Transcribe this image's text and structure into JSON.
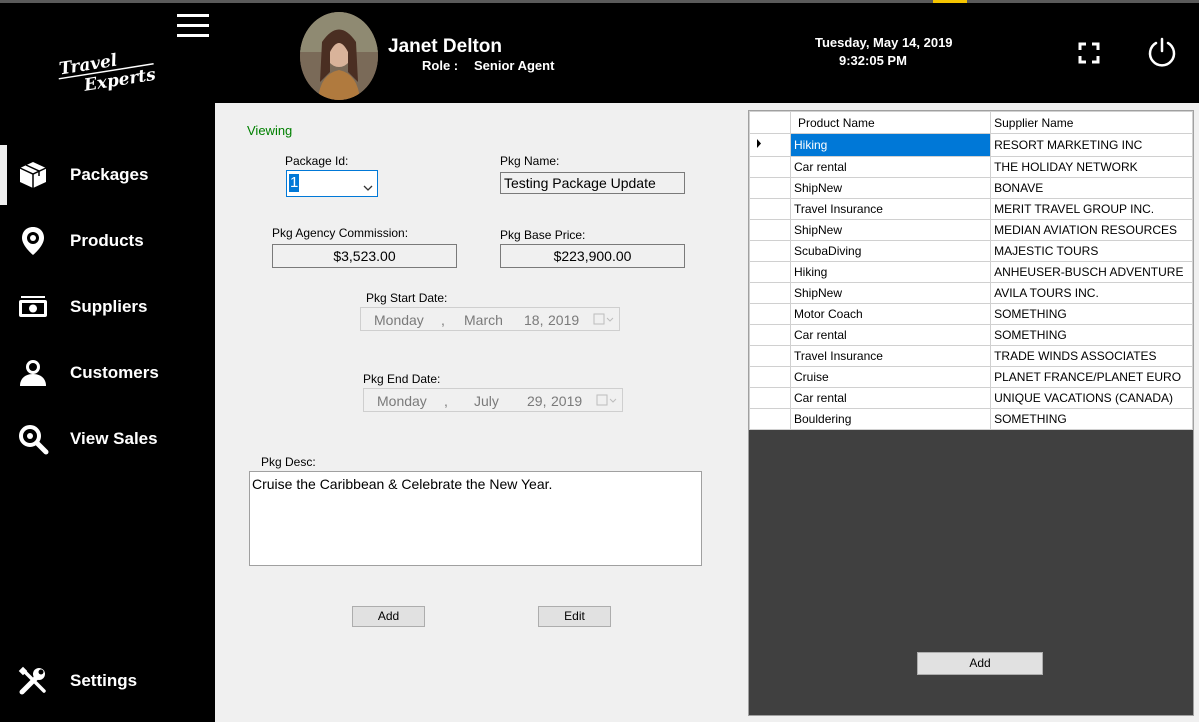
{
  "header": {
    "logo_line1": "Travel",
    "logo_line2": "Experts",
    "user_name": "Janet Delton",
    "role_label": "Role :",
    "role_value": "Senior Agent",
    "date": "Tuesday, May 14, 2019",
    "time": "9:32:05 PM",
    "icons": [
      "hamburger-menu-icon",
      "fullscreen-icon",
      "power-icon"
    ]
  },
  "sidebar": {
    "items": [
      {
        "label": "Packages",
        "icon": "package-box-icon",
        "active": true
      },
      {
        "label": "Products",
        "icon": "location-pin-icon"
      },
      {
        "label": "Suppliers",
        "icon": "money-stack-icon"
      },
      {
        "label": "Customers",
        "icon": "users-icon"
      },
      {
        "label": "View Sales",
        "icon": "magnifier-icon"
      },
      {
        "label": "Settings",
        "icon": "wrench-screwdriver-icon"
      }
    ]
  },
  "form": {
    "mode_text": "Viewing",
    "package_id_label": "Package Id:",
    "package_id_value": "1",
    "pkg_name_label": "Pkg Name:",
    "pkg_name_value": "Testing Package Update",
    "commission_label": "Pkg Agency Commission:",
    "commission_value": "$3,523.00",
    "base_price_label": "Pkg Base Price:",
    "base_price_value": "$223,900.00",
    "start_date_label": "Pkg Start Date:",
    "start_date": {
      "weekday": "Monday",
      "sep": ",",
      "month": "March",
      "daynum": "18,",
      "year": "2019"
    },
    "end_date_label": "Pkg End Date:",
    "end_date": {
      "weekday": "Monday",
      "sep": ",",
      "month": "July",
      "daynum": "29,",
      "year": "2019"
    },
    "desc_label": "Pkg Desc:",
    "desc_value": "Cruise the Caribbean & Celebrate the New Year.",
    "add_button": "Add",
    "edit_button": "Edit"
  },
  "grid": {
    "columns": [
      "Product Name",
      "Supplier Name"
    ],
    "rows": [
      [
        "Hiking",
        "RESORT MARKETING INC"
      ],
      [
        "Car rental",
        "THE HOLIDAY NETWORK"
      ],
      [
        "ShipNew",
        "BONAVE"
      ],
      [
        "Travel Insurance",
        "MERIT TRAVEL GROUP INC."
      ],
      [
        "ShipNew",
        "MEDIAN AVIATION RESOURCES"
      ],
      [
        "ScubaDiving",
        "MAJESTIC TOURS"
      ],
      [
        "Hiking",
        "ANHEUSER-BUSCH ADVENTURE"
      ],
      [
        "ShipNew",
        "AVILA TOURS INC."
      ],
      [
        "Motor Coach",
        "SOMETHING"
      ],
      [
        "Car rental",
        "SOMETHING"
      ],
      [
        "Travel Insurance",
        "TRADE WINDS ASSOCIATES"
      ],
      [
        "Cruise",
        "PLANET FRANCE/PLANET EURO"
      ],
      [
        "Car rental",
        "UNIQUE VACATIONS (CANADA)"
      ],
      [
        "Bouldering",
        "SOMETHING"
      ]
    ],
    "selected_row": 0,
    "add_button": "Add"
  },
  "colors": {
    "accent": "#f5c400",
    "viewing_text": "#008000",
    "selection": "#0078d7"
  }
}
